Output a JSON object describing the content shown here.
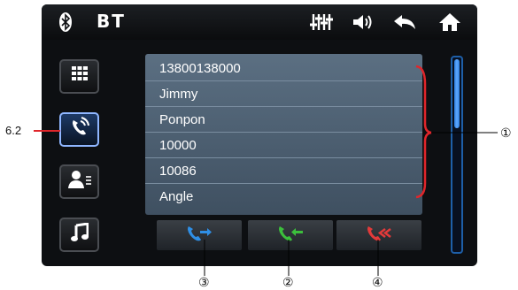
{
  "status_bar": {
    "bluetooth_icon": "bluetooth-icon",
    "title": "BT",
    "icons": [
      "equalizer-icon",
      "volume-icon",
      "back-icon",
      "home-icon"
    ]
  },
  "sidebar": {
    "items": [
      {
        "name": "dialpad",
        "icon": "dialpad-icon",
        "active": false
      },
      {
        "name": "call-log",
        "icon": "call-log-icon",
        "active": true
      },
      {
        "name": "contacts",
        "icon": "contacts-icon",
        "active": false
      },
      {
        "name": "music",
        "icon": "music-icon",
        "active": false
      }
    ]
  },
  "call_list": {
    "entries": [
      "13800138000",
      "Jimmy",
      "Ponpon",
      "10000",
      "10086",
      "Angle"
    ]
  },
  "actions": [
    {
      "name": "outgoing",
      "icon": "outgoing-call-icon",
      "color": "#2f8fe6"
    },
    {
      "name": "received",
      "icon": "received-call-icon",
      "color": "#3cbf3c"
    },
    {
      "name": "missed",
      "icon": "missed-call-icon",
      "color": "#e23a3a"
    }
  ],
  "callouts": {
    "side_label": "6.2",
    "list_label": "①",
    "btn1_label": "③",
    "btn2_label": "②",
    "btn3_label": "④"
  },
  "colors": {
    "bracket": "#e0262b",
    "accent": "#1e6fd0"
  }
}
